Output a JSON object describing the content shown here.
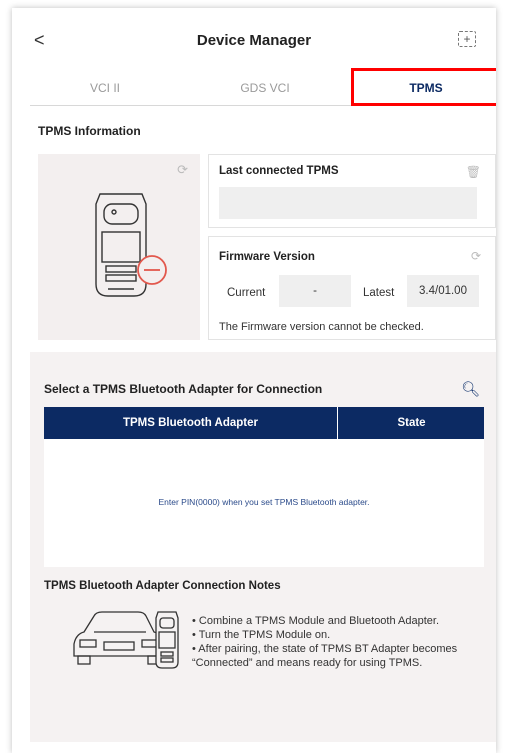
{
  "header": {
    "back_label": "<",
    "title": "Device Manager",
    "expand_label": "+"
  },
  "tabs": [
    {
      "label": "VCI II",
      "active": false
    },
    {
      "label": "GDS VCI",
      "active": false
    },
    {
      "label": "TPMS",
      "active": true
    }
  ],
  "info": {
    "section_title": "TPMS Information",
    "last_connected_title": "Last connected TPMS",
    "last_connected_value": "",
    "firmware_title": "Firmware Version",
    "current_label": "Current",
    "current_value": "-",
    "latest_label": "Latest",
    "latest_value": "3.4/01.00",
    "firmware_note": "The Firmware version cannot be checked."
  },
  "adapter": {
    "section_title": "Select a TPMS Bluetooth Adapter for Connection",
    "columns": [
      "TPMS Bluetooth Adapter",
      "State"
    ],
    "empty_message": "Enter PIN(0000) when you set TPMS Bluetooth adapter."
  },
  "notes": {
    "title": "TPMS Bluetooth Adapter Connection Notes",
    "items": [
      "• Combine a TPMS Module and Bluetooth Adapter.",
      "• Turn the TPMS Module on.",
      "• After pairing, the state of TPMS BT Adapter becomes “Connected” and means ready for using TPMS."
    ]
  },
  "colors": {
    "navy": "#0c2a63",
    "highlight": "#ff0000",
    "panel": "#f5f2f2"
  }
}
